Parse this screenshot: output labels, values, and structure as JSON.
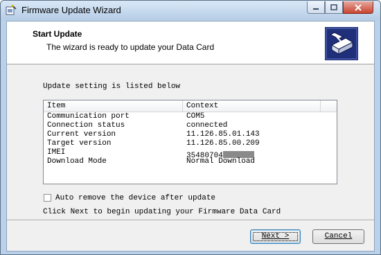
{
  "window": {
    "title": "Firmware Update Wizard"
  },
  "icons": {
    "app": "wizard-icon",
    "logo": "device-update-icon",
    "minimize": "minimize-icon",
    "maximize": "maximize-icon",
    "close": "close-icon"
  },
  "header": {
    "title": "Start Update",
    "subtitle": "The wizard is ready to update your Data Card"
  },
  "content": {
    "intro": "Update setting is listed below",
    "columns": [
      "Item",
      "Context"
    ],
    "rows": [
      {
        "item": "Communication port",
        "context": "COM5"
      },
      {
        "item": "Connection status",
        "context": "connected"
      },
      {
        "item": "Current version",
        "context": "11.126.85.01.143"
      },
      {
        "item": "Target version",
        "context": "11.126.85.00.209"
      },
      {
        "item": "IMEI",
        "context": "35480704"
      },
      {
        "item": "Download Mode",
        "context": "Normal Download"
      }
    ],
    "checkbox_label": "Auto remove the device after update",
    "checkbox_checked": false,
    "hint": "Click Next to begin updating your Firmware Data Card"
  },
  "buttons": {
    "next": "Next >",
    "cancel": "Cancel"
  },
  "colors": {
    "titlebar": "#b6cde6",
    "close": "#c7432f",
    "dialog": "#f0f0f0",
    "logo_bg": "#1f2f7a"
  }
}
